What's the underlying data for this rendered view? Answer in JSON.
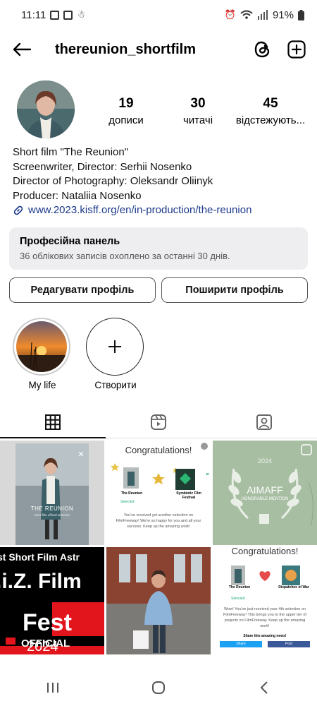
{
  "status_bar": {
    "time": "11:11",
    "battery": "91%"
  },
  "header": {
    "username": "thereunion_shortfilm"
  },
  "stats": [
    {
      "num": "19",
      "label": "дописи"
    },
    {
      "num": "30",
      "label": "читачі"
    },
    {
      "num": "45",
      "label": "відстежують..."
    }
  ],
  "bio": {
    "lines": [
      "Short film \"The Reunion\"",
      "Screenwriter, Director: Serhii Nosenko",
      "Director of Photography: Oleksandr Oliinyk",
      "Producer: Nataliia Nosenko"
    ],
    "link": "www.2023.kisff.org/en/in-production/the-reunion"
  },
  "pro_panel": {
    "title": "Професійна панель",
    "subtitle": "36 облікових записів охоплено за останні 30 днів."
  },
  "buttons": {
    "edit": "Редагувати профіль",
    "share": "Поширити профіль"
  },
  "highlights": [
    {
      "label": "My life"
    },
    {
      "label": "Створити"
    }
  ],
  "posts": {
    "p1": {
      "title": "THE REUNION",
      "subtitle": "short film official selection"
    },
    "p2": {
      "heading": "Congratulations!",
      "left": "The Reunion",
      "right": "Symbiotic Film Festival",
      "status": "Selected",
      "body": "You've received yet another selection on FilmFreeway! We're so happy for you and all your success. Keep up the amazing work!"
    },
    "p3": {
      "year": "2024",
      "name": "AIMAFF",
      "sub": "HONORABLE MENTION"
    },
    "p4": {
      "line1": "st Short Film Astr",
      "line2": ".i.Z. Film",
      "line3": "Fest",
      "line4": "2024",
      "line5": "OFFICIAL"
    },
    "p6": {
      "heading": "Congratulations!",
      "left": "The Reunion",
      "right": "Dispatches of War",
      "status": "Selected",
      "body": "Wow! You've just received your 4th selection on FilmFreeway! This brings you to the upper tier of projects on FilmFreeway. Keep up the amazing work!",
      "share": "Share this amazing news!",
      "btn1": "Share",
      "btn2": "Post"
    }
  },
  "colors": {
    "link": "#1d3a8a",
    "panel_bg": "#eeeef0",
    "grid_bg": "#ffffff"
  }
}
